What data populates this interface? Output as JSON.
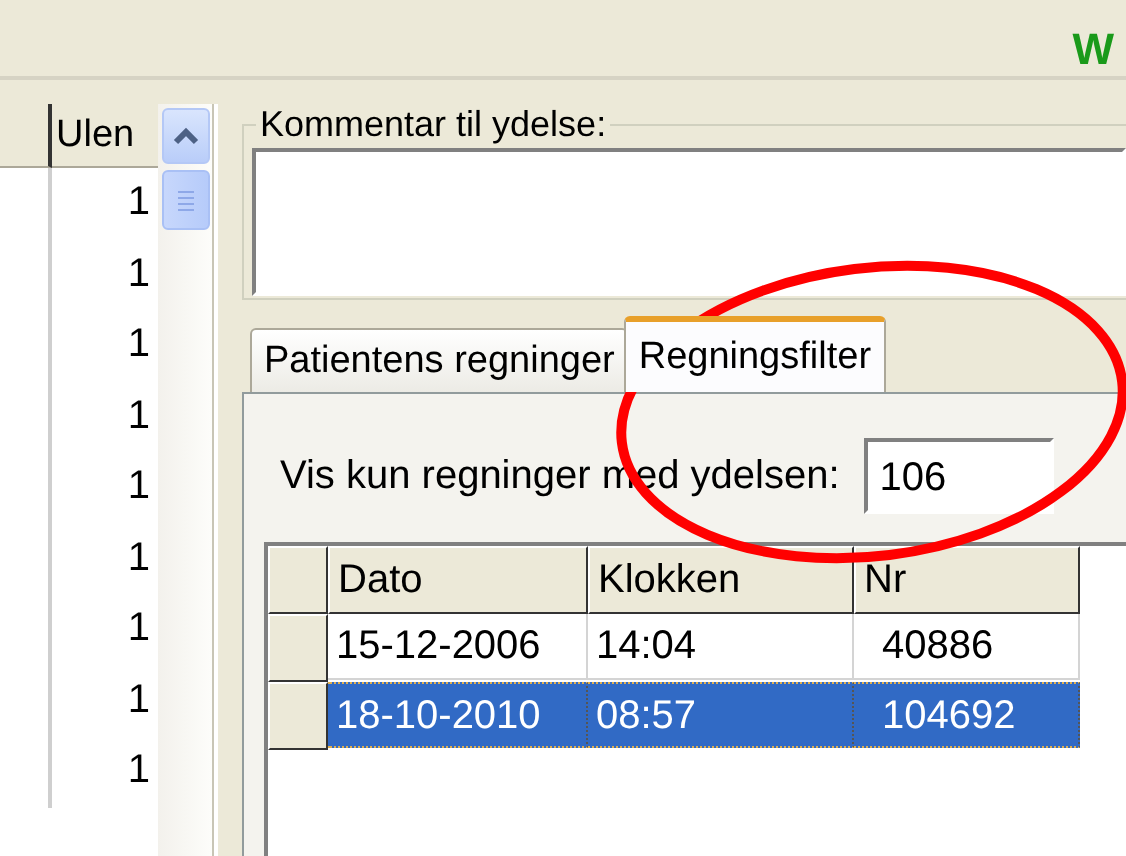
{
  "header": {
    "logo_text": "W"
  },
  "left_grid": {
    "column_header": "Ulen",
    "values": [
      "1",
      "1",
      "1",
      "1",
      "1",
      "1",
      "1",
      "1",
      "1"
    ]
  },
  "comment": {
    "label": "Kommentar til ydelse:"
  },
  "tabs": [
    {
      "label": "Patientens regninger",
      "selected": false
    },
    {
      "label": "Regningsfilter",
      "selected": true
    }
  ],
  "filter": {
    "label": "Vis kun regninger med ydelsen:",
    "value": "106",
    "circled": true
  },
  "bills": {
    "columns": [
      "Dato",
      "Klokken",
      "Nr"
    ],
    "rows": [
      {
        "cells": [
          "15-12-2006",
          "14:04",
          "40886"
        ],
        "selected": false
      },
      {
        "cells": [
          "18-10-2010",
          "08:57",
          "104692"
        ],
        "selected": true
      }
    ]
  }
}
